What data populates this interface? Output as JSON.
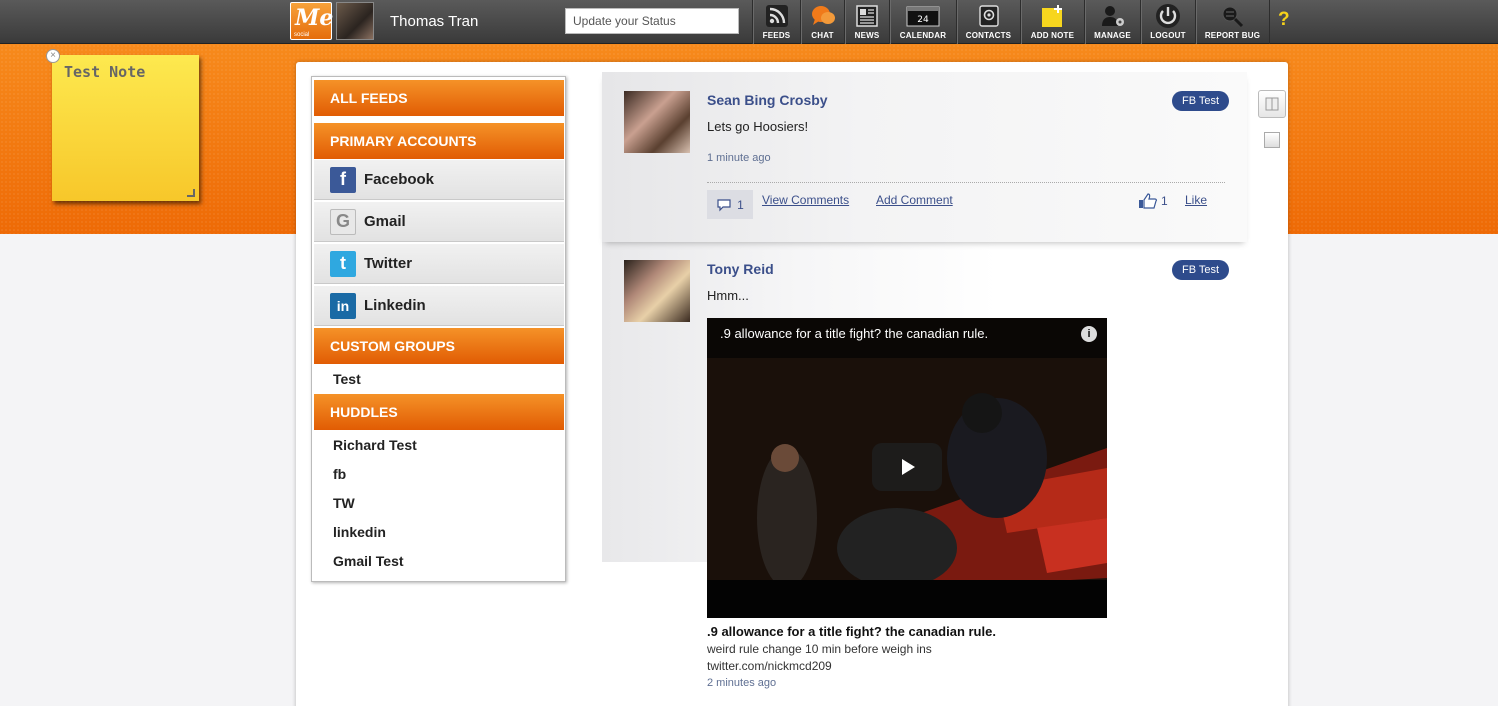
{
  "header": {
    "logo_text": "Me",
    "logo_sub": "social",
    "username": "Thomas Tran",
    "status_placeholder": "Update your Status",
    "nav": [
      {
        "label": "FEEDS",
        "icon": "rss-icon"
      },
      {
        "label": "CHAT",
        "icon": "chat-icon"
      },
      {
        "label": "NEWS",
        "icon": "news-icon"
      },
      {
        "label": "CALENDAR",
        "icon": "calendar-icon",
        "day": "24"
      },
      {
        "label": "CONTACTS",
        "icon": "contacts-icon"
      },
      {
        "label": "ADD NOTE",
        "icon": "add-note-icon"
      },
      {
        "label": "MANAGE",
        "icon": "manage-icon"
      },
      {
        "label": "LOGOUT",
        "icon": "power-icon"
      },
      {
        "label": "REPORT BUG",
        "icon": "bug-icon"
      }
    ],
    "help": "?"
  },
  "note": {
    "title": "Test Note"
  },
  "sidebar": {
    "all_feeds": "ALL FEEDS",
    "primary_accounts": "PRIMARY ACCOUNTS",
    "accounts": [
      {
        "label": "Facebook",
        "icon": "facebook-icon",
        "glyph": "f",
        "color": "#3b5998"
      },
      {
        "label": "Gmail",
        "icon": "google-icon",
        "glyph": "G",
        "color": "#e8e8e8"
      },
      {
        "label": "Twitter",
        "icon": "twitter-icon",
        "glyph": "t",
        "color": "#2fa8e0"
      },
      {
        "label": "Linkedin",
        "icon": "linkedin-icon",
        "glyph": "in",
        "color": "#1a6aa5"
      }
    ],
    "custom_groups": "CUSTOM GROUPS",
    "groups": [
      "Test"
    ],
    "huddles": "HUDDLES",
    "huddle_items": [
      "Richard Test",
      "fb",
      "TW",
      "linkedin",
      "Gmail Test"
    ]
  },
  "posts": [
    {
      "name": "Sean Bing Crosby",
      "text": "Lets go Hoosiers!",
      "time": "1 minute ago",
      "badge": "FB Test",
      "comment_count": "1",
      "view_comments": "View Comments",
      "add_comment": "Add Comment",
      "like_count": "1",
      "like": "Like"
    },
    {
      "name": "Tony Reid",
      "text": "Hmm...",
      "badge": "FB Test",
      "video_title": ".9 allowance for a title fight? the canadian rule.",
      "link_title": ".9 allowance for a title fight? the canadian rule.",
      "link_desc": "weird rule change 10 min before weigh ins",
      "link_source": "twitter.com/nickmcd209",
      "time": "2 minutes ago"
    }
  ]
}
